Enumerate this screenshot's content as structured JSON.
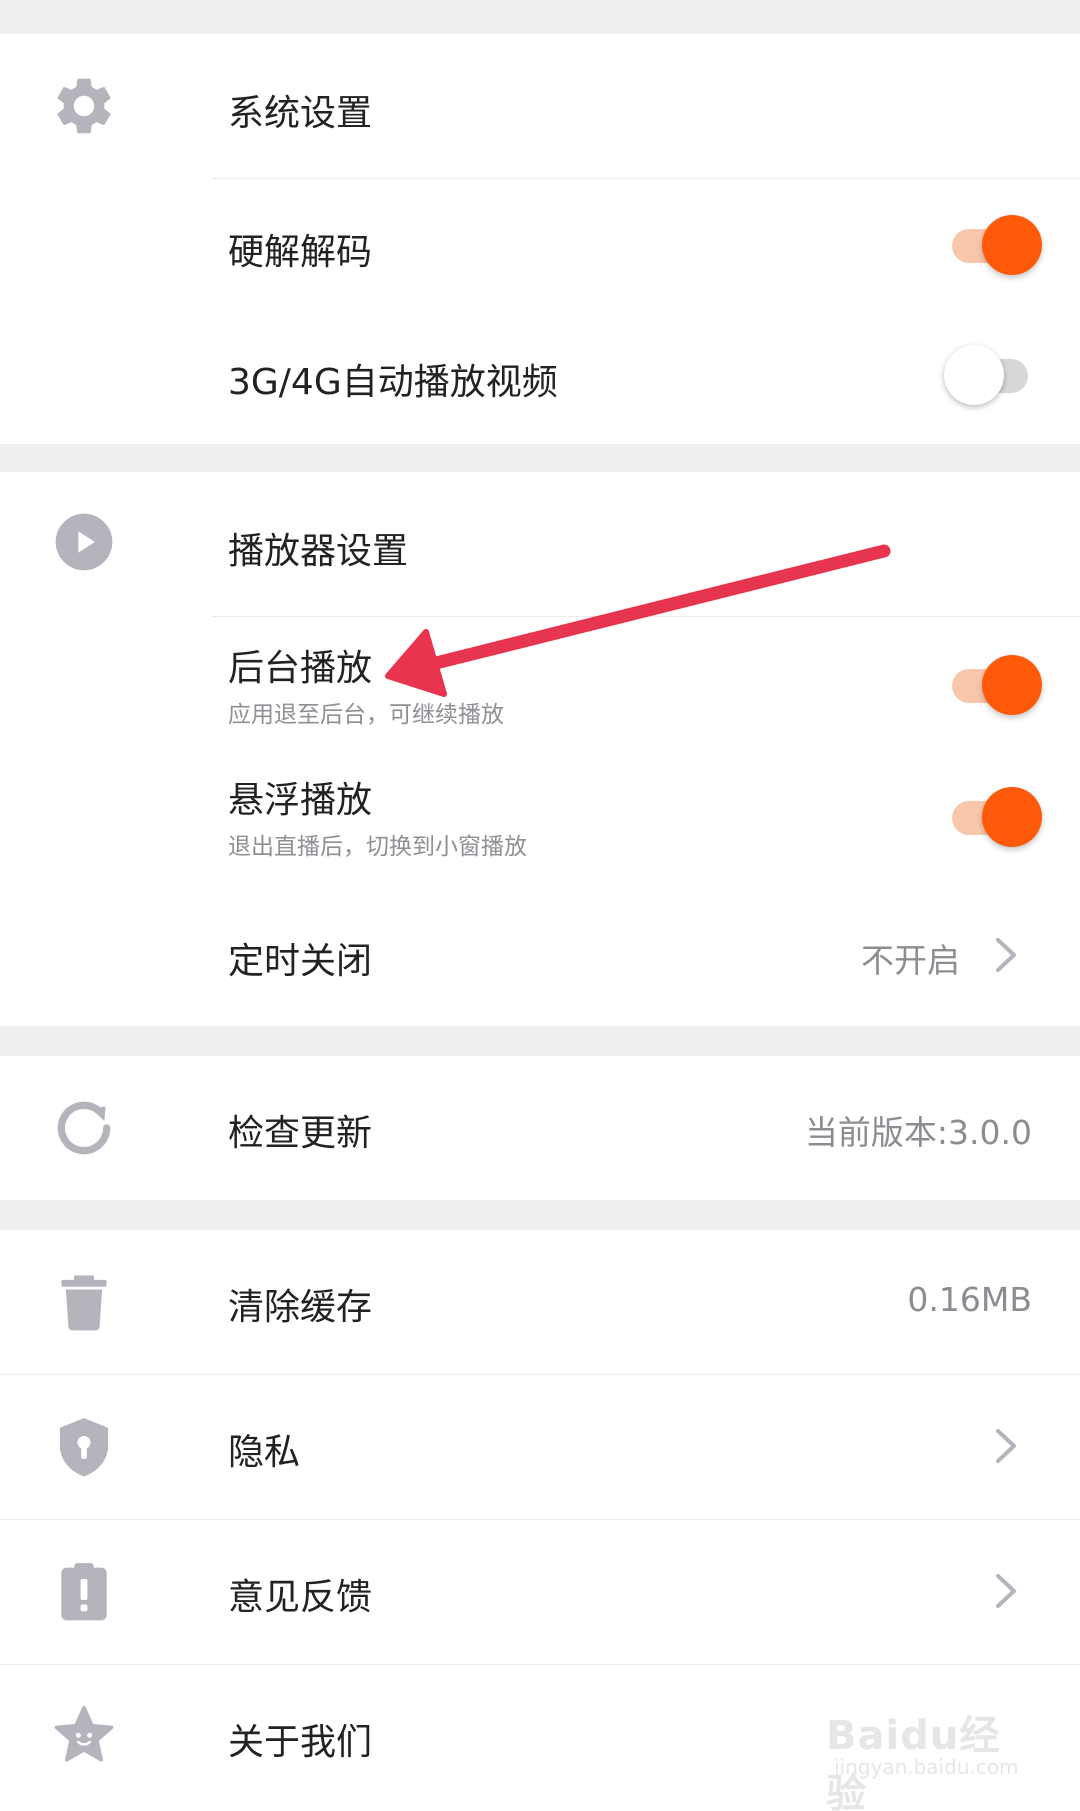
{
  "colors": {
    "accent": "#ff5a0a",
    "accent_track": "#f8c7ab",
    "icon_gray": "#b4b4bc",
    "annotation_arrow": "#e8344e"
  },
  "system": {
    "header_icon": "gear-icon",
    "header_label": "系统设置",
    "hw_decode": {
      "label": "硬解解码",
      "toggle_on": true
    },
    "auto_play": {
      "label": "3G/4G自动播放视频",
      "toggle_on": false
    }
  },
  "player": {
    "header_icon": "play-circle-icon",
    "header_label": "播放器设置",
    "background_play": {
      "label": "后台播放",
      "sublabel": "应用退至后台，可继续播放",
      "toggle_on": true
    },
    "float_play": {
      "label": "悬浮播放",
      "sublabel": "退出直播后，切换到小窗播放",
      "toggle_on": true
    },
    "timer_close": {
      "label": "定时关闭",
      "value": "不开启"
    }
  },
  "update": {
    "icon": "refresh-icon",
    "label": "检查更新",
    "value": "当前版本:3.0.0"
  },
  "misc": {
    "clear_cache": {
      "icon": "trash-icon",
      "label": "清除缓存",
      "value": "0.16MB"
    },
    "privacy": {
      "icon": "shield-icon",
      "label": "隐私"
    },
    "feedback": {
      "icon": "clipboard-alert-icon",
      "label": "意见反馈"
    },
    "about": {
      "icon": "star-face-icon",
      "label": "关于我们"
    }
  },
  "watermark": {
    "text": "Baidu经验",
    "sub": "jingyan.baidu.com"
  }
}
